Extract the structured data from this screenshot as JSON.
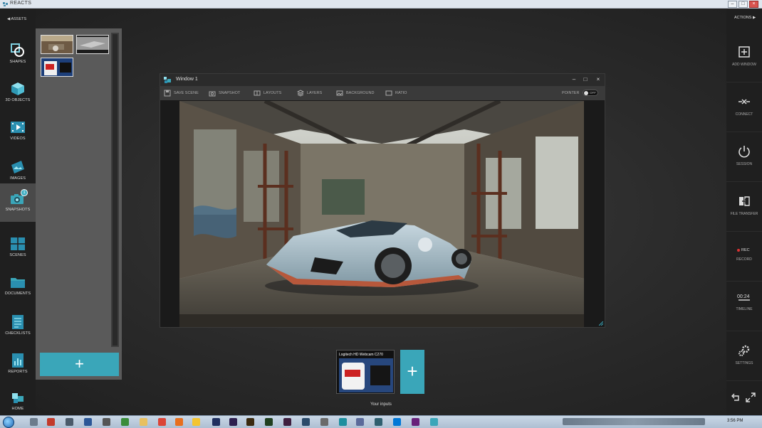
{
  "window_title": "REACTS",
  "left_rail": {
    "assets_label": "ASSETS",
    "items": [
      {
        "label": "SHAPES",
        "icon": "shapes-icon"
      },
      {
        "label": "3D OBJECTS",
        "icon": "cube-icon"
      },
      {
        "label": "VIDEOS",
        "icon": "video-icon"
      },
      {
        "label": "IMAGES",
        "icon": "image-icon"
      },
      {
        "label": "SNAPSHOTS",
        "icon": "camera-icon",
        "badge": "1",
        "active": true
      },
      {
        "label": "SCENES",
        "icon": "scenes-icon"
      },
      {
        "label": "DOCUMENTS",
        "icon": "folder-icon"
      },
      {
        "label": "CHECKLISTS",
        "icon": "checklist-icon"
      },
      {
        "label": "REPORTS",
        "icon": "reports-icon"
      },
      {
        "label": "HOME",
        "icon": "home-icon"
      }
    ]
  },
  "assets_panel": {
    "add_label": "+"
  },
  "scene_window": {
    "title": "Window 1",
    "minimize": "–",
    "maximize": "□",
    "close": "×",
    "toolbar": {
      "save_scene": "SAVE SCENE",
      "snapshot": "SNAPSHOT",
      "layouts": "LAYOUTS",
      "layers": "LAYERS",
      "background": "BACKGROUND",
      "ratio": "RATIO",
      "pointer": "POINTER",
      "pointer_state": "OFF"
    }
  },
  "inputs": {
    "camera_name": "Logitech HD Webcam C270",
    "add_label": "+",
    "caption": "Your inputs"
  },
  "right_rail": {
    "actions_label": "ACTIONS",
    "items": [
      {
        "label": "ADD WINDOW",
        "icon": "add-window-icon"
      },
      {
        "label": "CONNECT",
        "icon": "connect-icon"
      },
      {
        "label": "SESSION",
        "icon": "power-icon"
      },
      {
        "label": "FILE TRANSFER",
        "icon": "file-transfer-icon"
      },
      {
        "label": "RECORD",
        "icon": "record-icon",
        "extra": "REC"
      },
      {
        "label": "TIMELINE",
        "icon": "timeline-icon",
        "extra": "00:24"
      },
      {
        "label": "SETTINGS",
        "icon": "settings-icon"
      }
    ]
  },
  "taskbar": {
    "clock": "3:56 PM"
  },
  "colors": {
    "accent": "#3aa6b9",
    "rail": "#1f1f1f",
    "panel": "#5a5a5a"
  }
}
